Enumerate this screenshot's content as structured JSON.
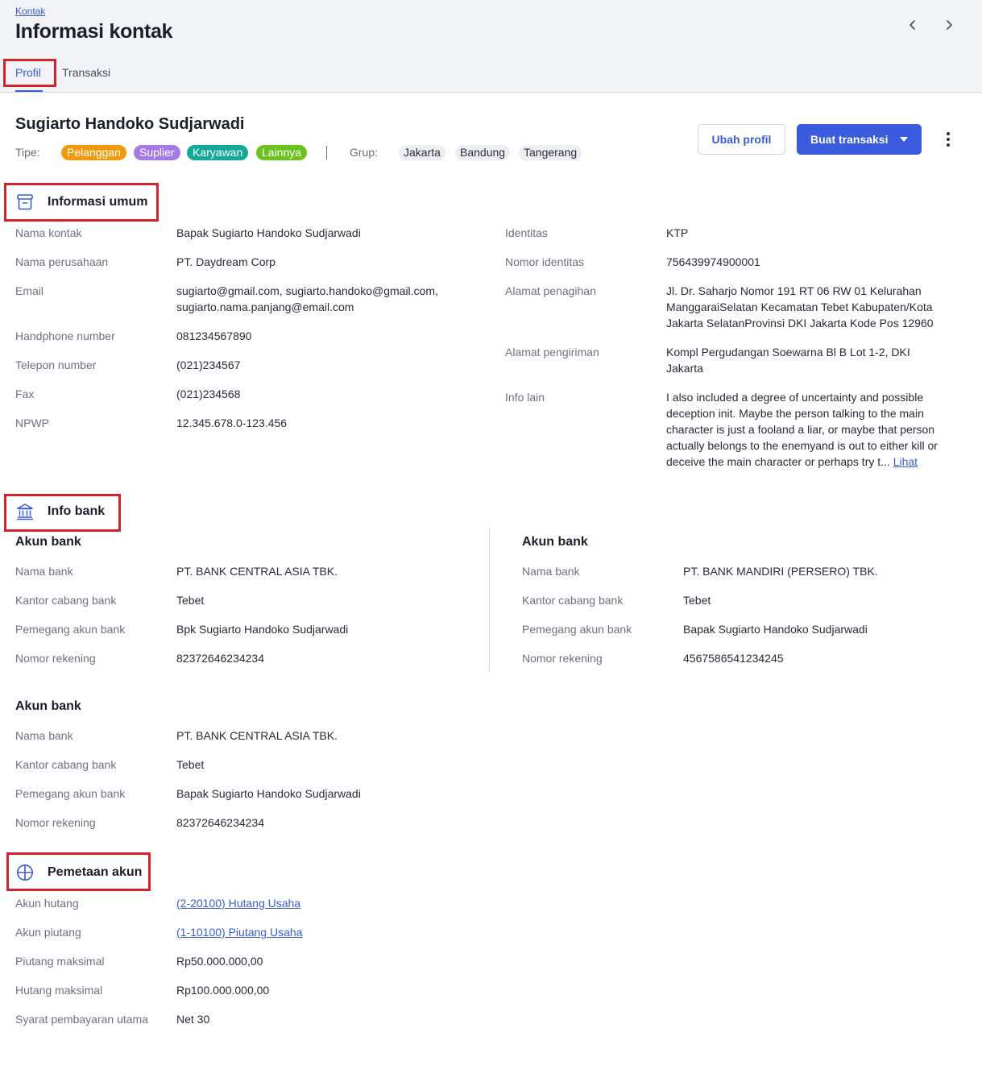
{
  "header": {
    "breadcrumb": "Kontak",
    "title": "Informasi kontak",
    "tabs": [
      "Profil",
      "Transaksi"
    ]
  },
  "contact": {
    "name": "Sugiarto Handoko Sudjarwadi",
    "type_label": "Tipe:",
    "types": [
      {
        "label": "Pelanggan",
        "color": "#f29a0c"
      },
      {
        "label": "Suplier",
        "color": "#a57ae8"
      },
      {
        "label": "Karyawan",
        "color": "#12a89a"
      },
      {
        "label": "Lainnya",
        "color": "#6cc21d"
      }
    ],
    "group_label": "Grup:",
    "groups": [
      "Jakarta",
      "Bandung",
      "Tangerang"
    ]
  },
  "actions": {
    "edit_label": "Ubah profil",
    "create_label": "Buat transaksi"
  },
  "general": {
    "title": "Informasi umum",
    "left": [
      {
        "label": "Nama kontak",
        "value": "Bapak Sugiarto Handoko Sudjarwadi"
      },
      {
        "label": "Nama perusahaan",
        "value": "PT. Daydream Corp"
      },
      {
        "label": "Email",
        "value": "sugiarto@gmail.com, sugiarto.handoko@gmail.com, sugiarto.nama.panjang@email.com"
      },
      {
        "label": "Handphone number",
        "value": "081234567890"
      },
      {
        "label": "Telepon number",
        "value": "(021)234567"
      },
      {
        "label": "Fax",
        "value": "(021)234568"
      },
      {
        "label": "NPWP",
        "value": "12.345.678.0-123.456"
      }
    ],
    "right": [
      {
        "label": "Identitas",
        "value": "KTP"
      },
      {
        "label": "Nomor identitas",
        "value": "756439974900001"
      },
      {
        "label": "Alamat penagihan",
        "value": "Jl. Dr. Saharjo Nomor 191 RT 06 RW 01 Kelurahan ManggaraiSelatan Kecamatan Tebet Kabupaten/Kota Jakarta SelatanProvinsi DKI Jakarta Kode Pos 12960"
      },
      {
        "label": "Alamat pengiriman",
        "value": "Kompl Pergudangan Soewarna Bl B Lot 1-2, DKI Jakarta"
      },
      {
        "label": "Info lain",
        "value": "I also included a degree of uncertainty and possible deception init. Maybe the person talking to the main character is just a fooland a liar, or maybe that person actually belongs to the enemyand is out to either kill or deceive the main character or perhaps try t...",
        "link": "Lihat"
      }
    ]
  },
  "bank": {
    "title": "Info bank",
    "accounts": [
      {
        "title": "Akun bank",
        "rows": [
          {
            "label": "Nama bank",
            "value": "PT. BANK CENTRAL ASIA TBK."
          },
          {
            "label": "Kantor cabang bank",
            "value": "Tebet"
          },
          {
            "label": "Pemegang akun bank",
            "value": "Bpk Sugiarto Handoko Sudjarwadi"
          },
          {
            "label": "Nomor rekening",
            "value": "82372646234234"
          }
        ]
      },
      {
        "title": "Akun bank",
        "rows": [
          {
            "label": "Nama bank",
            "value": "PT. BANK MANDIRI (PERSERO) TBK."
          },
          {
            "label": "Kantor cabang bank",
            "value": "Tebet"
          },
          {
            "label": "Pemegang akun bank",
            "value": "Bapak Sugiarto Handoko Sudjarwadi"
          },
          {
            "label": "Nomor rekening",
            "value": "4567586541234245"
          }
        ]
      },
      {
        "title": "Akun bank",
        "rows": [
          {
            "label": "Nama bank",
            "value": "PT. BANK CENTRAL ASIA TBK."
          },
          {
            "label": "Kantor cabang bank",
            "value": "Tebet"
          },
          {
            "label": "Pemegang akun bank",
            "value": "Bapak Sugiarto Handoko Sudjarwadi"
          },
          {
            "label": "Nomor rekening",
            "value": "82372646234234"
          }
        ]
      }
    ]
  },
  "mapping": {
    "title": "Pemetaan akun",
    "rows": [
      {
        "label": "Akun hutang",
        "value": "(2-20100) Hutang Usaha"
      },
      {
        "label": "Akun piutang",
        "value": "(1-10100) Piutang Usaha"
      },
      {
        "label": "Piutang maksimal",
        "value": "Rp50.000.000,00"
      },
      {
        "label": "Hutang maksimal",
        "value": "Rp100.000.000,00"
      },
      {
        "label": "Syarat pembayaran utama",
        "value": "Net 30"
      }
    ]
  },
  "icons": {
    "prev": "chevron-left-icon",
    "next": "chevron-right-icon",
    "more": "more-vertical-icon",
    "general": "archive-box-icon",
    "bank": "bank-building-icon",
    "mapping": "grid-circle-icon"
  },
  "colors": {
    "accent": "#3b5bd6",
    "highlight": "#d3232d"
  }
}
